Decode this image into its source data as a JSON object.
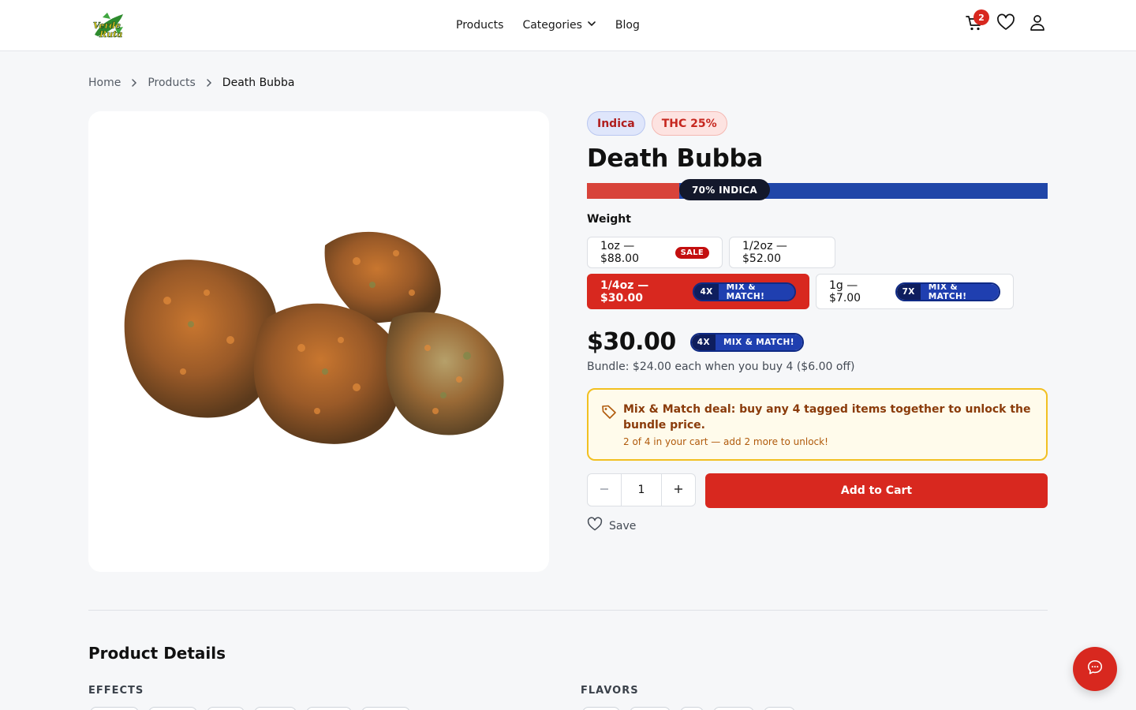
{
  "header": {
    "logo_text": "Verde Ruta",
    "nav": [
      {
        "label": "Products"
      },
      {
        "label": "Categories"
      },
      {
        "label": "Blog"
      }
    ],
    "cart_count": "2"
  },
  "breadcrumb": {
    "home": "Home",
    "products": "Products",
    "current": "Death Bubba"
  },
  "product": {
    "badges": {
      "type": "Indica",
      "thc": "THC 25%"
    },
    "name": "Death Bubba",
    "strain_bar": {
      "label": "70% INDICA",
      "indica_fraction": 0.7
    },
    "weight_label": "Weight",
    "options": [
      {
        "label": "1oz — $88.00",
        "tag": "SALE"
      },
      {
        "label": "1/2oz — $52.00"
      },
      {
        "label": "1/4oz — $30.00",
        "mix_x": "4X",
        "mix_text": "MIX & MATCH!",
        "selected": true
      },
      {
        "label": "1g — $7.00",
        "mix_x": "7X",
        "mix_text": "MIX & MATCH!"
      }
    ],
    "price": "$30.00",
    "price_mix_x": "4X",
    "price_mix_text": "MIX & MATCH!",
    "bundle_text": "Bundle: $24.00 each when you buy 4 ($6.00 off)",
    "deal": {
      "main": "Mix & Match deal: buy any 4 tagged items together to unlock the bundle price.",
      "sub": "2 of 4 in your cart — add 2 more to unlock!"
    },
    "quantity": "1",
    "add_to_cart": "Add to Cart",
    "save": "Save"
  },
  "details": {
    "title": "Product Details",
    "effects_label": "EFFECTS",
    "flavors_label": "FLAVORS"
  },
  "colors": {
    "accent_red": "#d8281f",
    "indica_blue": "#2046a8",
    "deal_border": "#f2c021"
  }
}
